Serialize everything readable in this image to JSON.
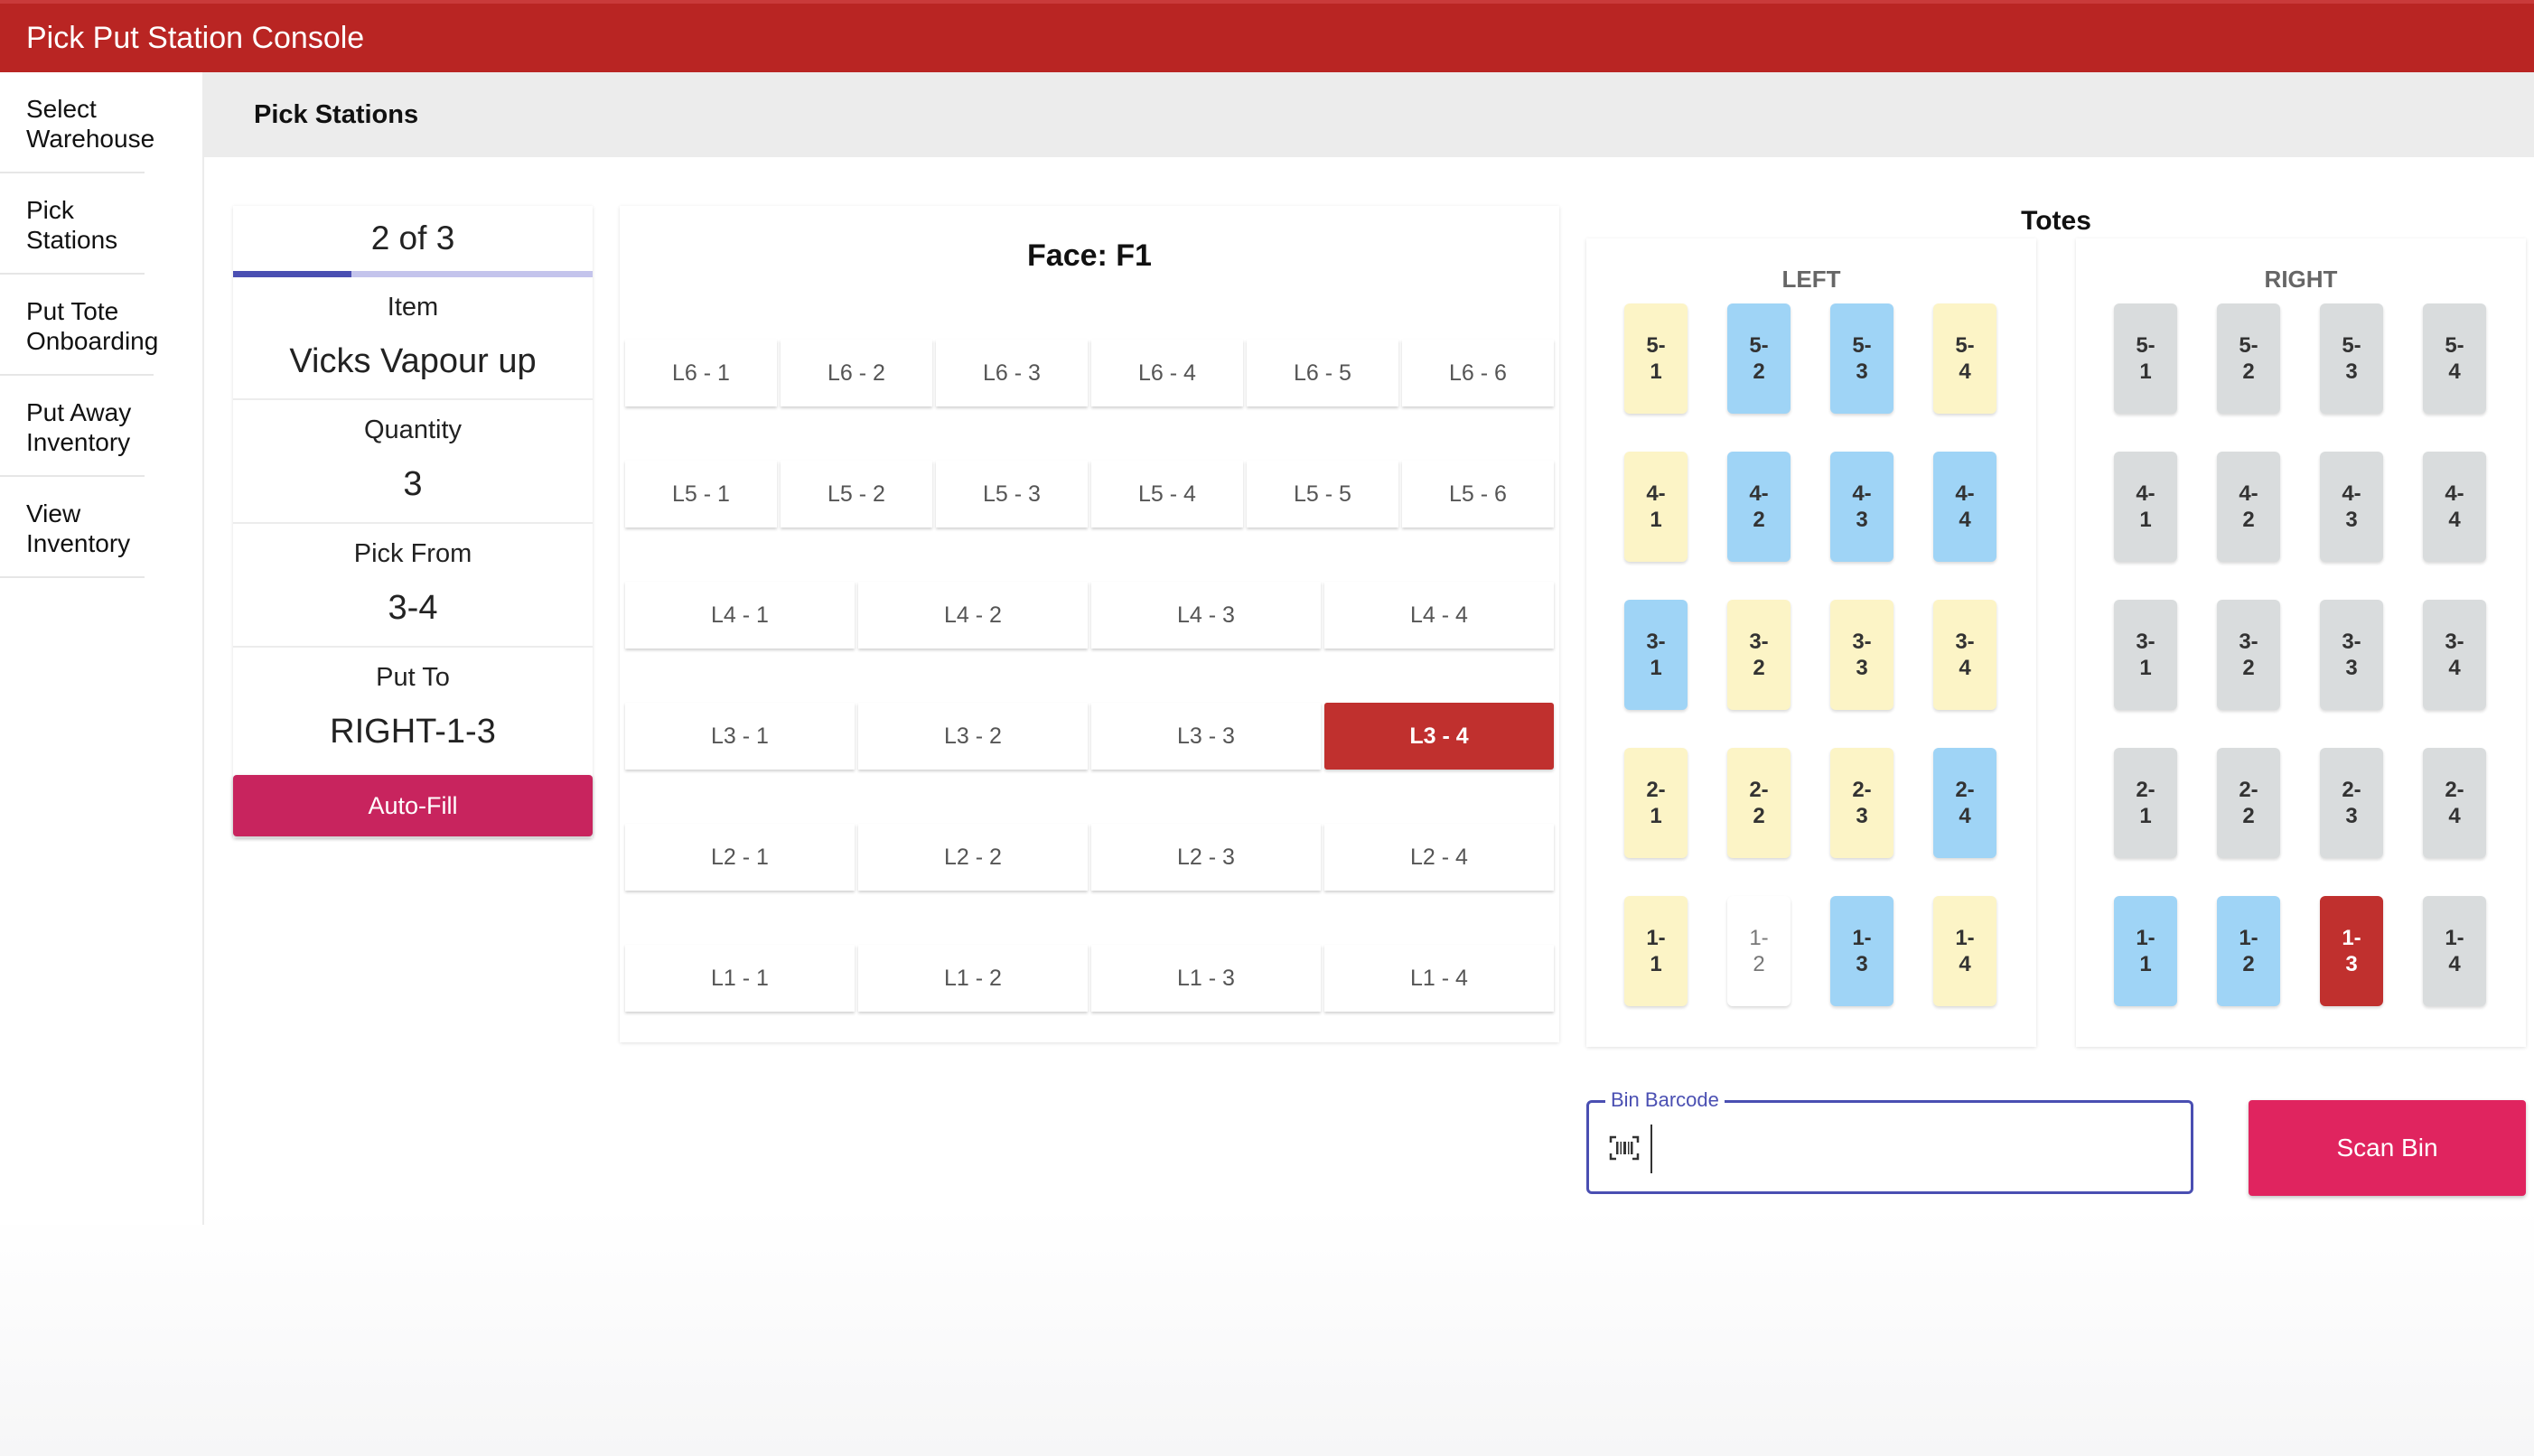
{
  "app": {
    "title": "Pick Put Station Console"
  },
  "sidebar": {
    "items": [
      {
        "label": "Select Warehouse"
      },
      {
        "label": "Pick Stations"
      },
      {
        "label": "Put Tote Onboarding"
      },
      {
        "label": "Put Away Inventory"
      },
      {
        "label": "View Inventory"
      }
    ]
  },
  "page": {
    "title": "Pick Stations"
  },
  "pick": {
    "counter": "2 of 3",
    "progress_fraction": 0.33,
    "item_label": "Item",
    "item_value": "Vicks Vapour up",
    "quantity_label": "Quantity",
    "quantity_value": "3",
    "pick_from_label": "Pick From",
    "pick_from_value": "3-4",
    "put_to_label": "Put To",
    "put_to_value": "RIGHT-1-3",
    "autofill_label": "Auto-Fill"
  },
  "face": {
    "title": "Face: F1",
    "rows": [
      [
        "L6 - 1",
        "L6 - 2",
        "L6 - 3",
        "L6 - 4",
        "L6 - 5",
        "L6 - 6"
      ],
      [
        "L5 - 1",
        "L5 - 2",
        "L5 - 3",
        "L5 - 4",
        "L5 - 5",
        "L5 - 6"
      ],
      [
        "L4 - 1",
        "L4 - 2",
        "L4 - 3",
        "L4 - 4"
      ],
      [
        "L3 - 1",
        "L3 - 2",
        "L3 - 3",
        "L3 - 4"
      ],
      [
        "L2 - 1",
        "L2 - 2",
        "L2 - 3",
        "L2 - 4"
      ],
      [
        "L1 - 1",
        "L1 - 2",
        "L1 - 3",
        "L1 - 4"
      ]
    ],
    "active": "L3 - 4"
  },
  "totes": {
    "title": "Totes",
    "left": {
      "label": "LEFT",
      "rows": [
        [
          {
            "t": "5-\n1",
            "c": "yellow"
          },
          {
            "t": "5-\n2",
            "c": "blue"
          },
          {
            "t": "5-\n3",
            "c": "blue"
          },
          {
            "t": "5-\n4",
            "c": "yellow"
          }
        ],
        [
          {
            "t": "4-\n1",
            "c": "yellow"
          },
          {
            "t": "4-\n2",
            "c": "blue"
          },
          {
            "t": "4-\n3",
            "c": "blue"
          },
          {
            "t": "4-\n4",
            "c": "blue"
          }
        ],
        [
          {
            "t": "3-\n1",
            "c": "blue"
          },
          {
            "t": "3-\n2",
            "c": "yellow"
          },
          {
            "t": "3-\n3",
            "c": "yellow"
          },
          {
            "t": "3-\n4",
            "c": "yellow"
          }
        ],
        [
          {
            "t": "2-\n1",
            "c": "yellow"
          },
          {
            "t": "2-\n2",
            "c": "yellow"
          },
          {
            "t": "2-\n3",
            "c": "yellow"
          },
          {
            "t": "2-\n4",
            "c": "blue"
          }
        ],
        [
          {
            "t": "1-\n1",
            "c": "yellow"
          },
          {
            "t": "1-\n2",
            "c": "white"
          },
          {
            "t": "1-\n3",
            "c": "blue"
          },
          {
            "t": "1-\n4",
            "c": "yellow"
          }
        ]
      ]
    },
    "right": {
      "label": "RIGHT",
      "rows": [
        [
          {
            "t": "5-\n1",
            "c": "grey"
          },
          {
            "t": "5-\n2",
            "c": "grey"
          },
          {
            "t": "5-\n3",
            "c": "grey"
          },
          {
            "t": "5-\n4",
            "c": "grey"
          }
        ],
        [
          {
            "t": "4-\n1",
            "c": "grey"
          },
          {
            "t": "4-\n2",
            "c": "grey"
          },
          {
            "t": "4-\n3",
            "c": "grey"
          },
          {
            "t": "4-\n4",
            "c": "grey"
          }
        ],
        [
          {
            "t": "3-\n1",
            "c": "grey"
          },
          {
            "t": "3-\n2",
            "c": "grey"
          },
          {
            "t": "3-\n3",
            "c": "grey"
          },
          {
            "t": "3-\n4",
            "c": "grey"
          }
        ],
        [
          {
            "t": "2-\n1",
            "c": "grey"
          },
          {
            "t": "2-\n2",
            "c": "grey"
          },
          {
            "t": "2-\n3",
            "c": "grey"
          },
          {
            "t": "2-\n4",
            "c": "grey"
          }
        ],
        [
          {
            "t": "1-\n1",
            "c": "blue"
          },
          {
            "t": "1-\n2",
            "c": "blue"
          },
          {
            "t": "1-\n3",
            "c": "red"
          },
          {
            "t": "1-\n4",
            "c": "grey"
          }
        ]
      ]
    }
  },
  "bin": {
    "label": "Bin Barcode",
    "value": "",
    "placeholder": "",
    "icon": "barcode-scanner-icon"
  },
  "scan": {
    "label": "Scan Bin"
  },
  "colors": {
    "appbar": "#b92523",
    "active_location": "#c0302e",
    "autofill": "#c8245e",
    "scan_button": "#e0245f",
    "accent": "#4a4fb2",
    "tote_yellow": "#fcf4c6",
    "tote_blue": "#9fd4f6",
    "tote_grey": "#d9dcdd"
  }
}
